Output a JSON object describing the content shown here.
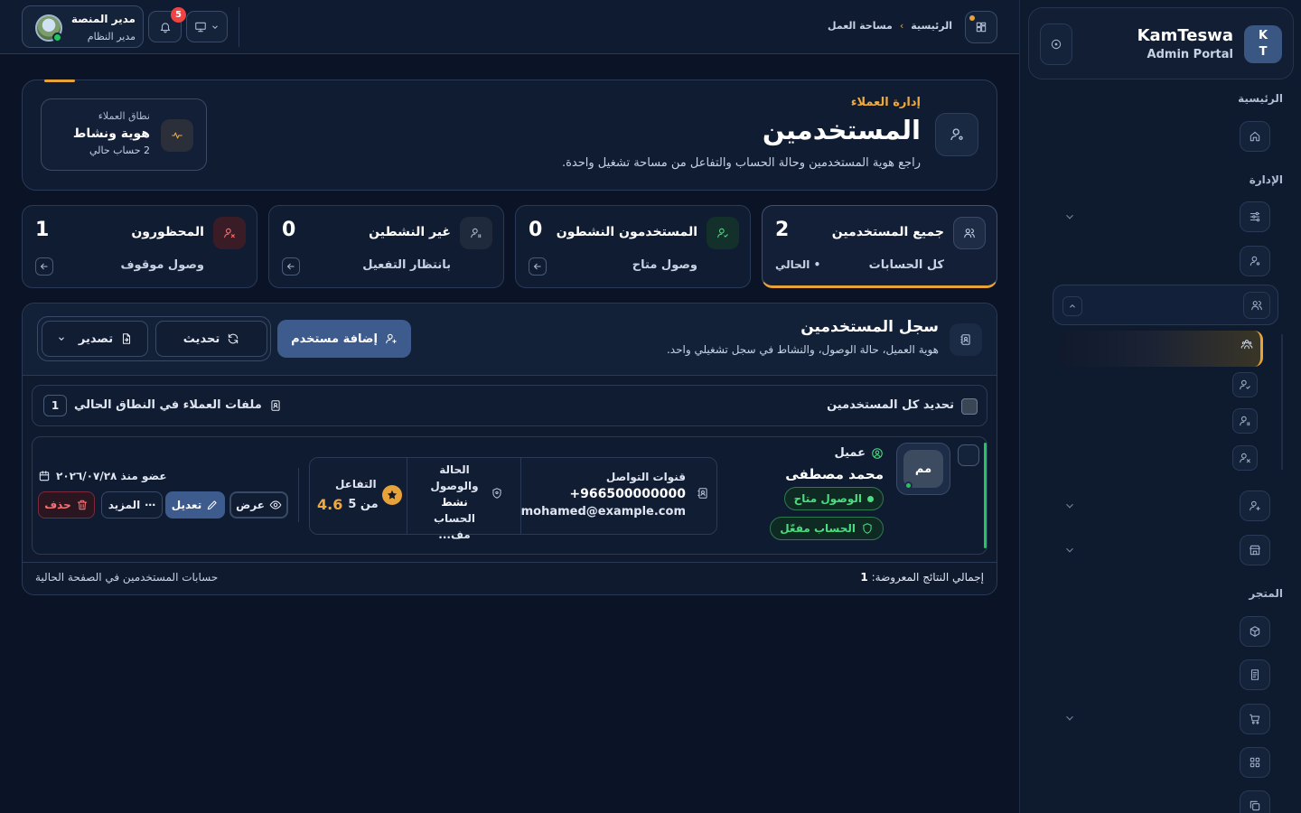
{
  "brand": {
    "logo_top": "K",
    "logo_bottom": "T",
    "name": "KamTeswa",
    "subtitle": "Admin Portal"
  },
  "sidebar": {
    "section_home": "الرئيسية",
    "section_admin": "الإدارة",
    "section_store": "المتجر"
  },
  "topbar": {
    "user_name": "مدير المنصة",
    "user_role": "مدير النظام",
    "notifications_count": "5",
    "breadcrumb": [
      "الرئيسية",
      "مساحة العمل"
    ]
  },
  "hero": {
    "kicker": "إدارة العملاء",
    "title": "المستخدمين",
    "description": "راجع هوية المستخدمين وحالة الحساب والتفاعل من مساحة تشغيل واحدة.",
    "scope_label": "نطاق العملاء",
    "scope_value": "هوية ونشاط",
    "scope_sub": "2 حساب حالي"
  },
  "stats": [
    {
      "title": "جميع المستخدمين",
      "value": "2",
      "subtitle": "كل الحسابات",
      "tag": "• الحالي"
    },
    {
      "title": "المستخدمون النشطون",
      "value": "0",
      "subtitle": "وصول متاح"
    },
    {
      "title": "غير النشطين",
      "value": "0",
      "subtitle": "بانتظار التفعيل"
    },
    {
      "title": "المحظورون",
      "value": "1",
      "subtitle": "وصول موقوف"
    }
  ],
  "registry": {
    "title": "سجل المستخدمين",
    "subtitle": "هوية العميل، حالة الوصول، والنشاط في سجل تشغيلي واحد.",
    "add_label": "إضافة مستخدم",
    "refresh_label": "تحديث",
    "export_label": "تصدير",
    "select_all_label": "تحديد كل المستخدمين",
    "files_label": "ملفات العملاء في النطاق الحالي",
    "files_count": "1"
  },
  "users": [
    {
      "initials": "مم",
      "role": "عميل",
      "name": "محمد مصطفى",
      "access_pill": "الوصول متاح",
      "account_pill": "الحساب مفعّل",
      "contact_label": "قنوات التواصل",
      "phone": "+966500000000",
      "email": "mohamed@example.com",
      "status_label": "الحالة والوصول",
      "status_value": "نشط",
      "status_extra": "الحساب مف...",
      "engagement_label": "التفاعل",
      "engagement_value": "4.6",
      "engagement_max": "من 5",
      "member_since": "عضو منذ ٢٠٢٦/٠٧/٢٨",
      "actions": {
        "view": "عرض",
        "edit": "تعديل",
        "more": "المزيد",
        "delete": "حذف"
      }
    }
  ],
  "footer": {
    "total_label": "إجمالي النتائج المعروضة:",
    "total_value": "1",
    "page_note": "حسابات المستخدمين في الصفحة الحالية"
  },
  "colors": {
    "accent": "#e8a23a",
    "primary": "#3d5b8c",
    "success": "#22c55e",
    "danger": "#ef4444"
  }
}
